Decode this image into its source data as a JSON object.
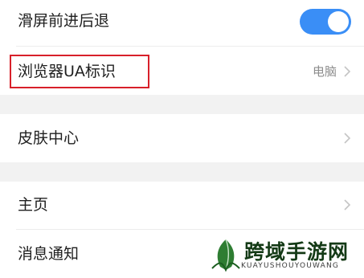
{
  "settings": {
    "swipe_nav": {
      "label": "滑屏前进后退",
      "enabled": true
    },
    "ua": {
      "label": "浏览器UA标识",
      "value": "电脑"
    },
    "skin": {
      "label": "皮肤中心"
    },
    "home": {
      "label": "主页"
    },
    "notify": {
      "label": "消息通知"
    }
  },
  "watermark": {
    "title": "跨域手游网",
    "subtitle": "KUAYUSHOUYOUWANG"
  },
  "colors": {
    "toggle_on": "#3a8ef6",
    "highlight": "#d8202a",
    "separator": "#f2f2f2"
  },
  "icons": {
    "chevron": "chevron-right-icon",
    "logo": "leaf-logo-icon"
  }
}
